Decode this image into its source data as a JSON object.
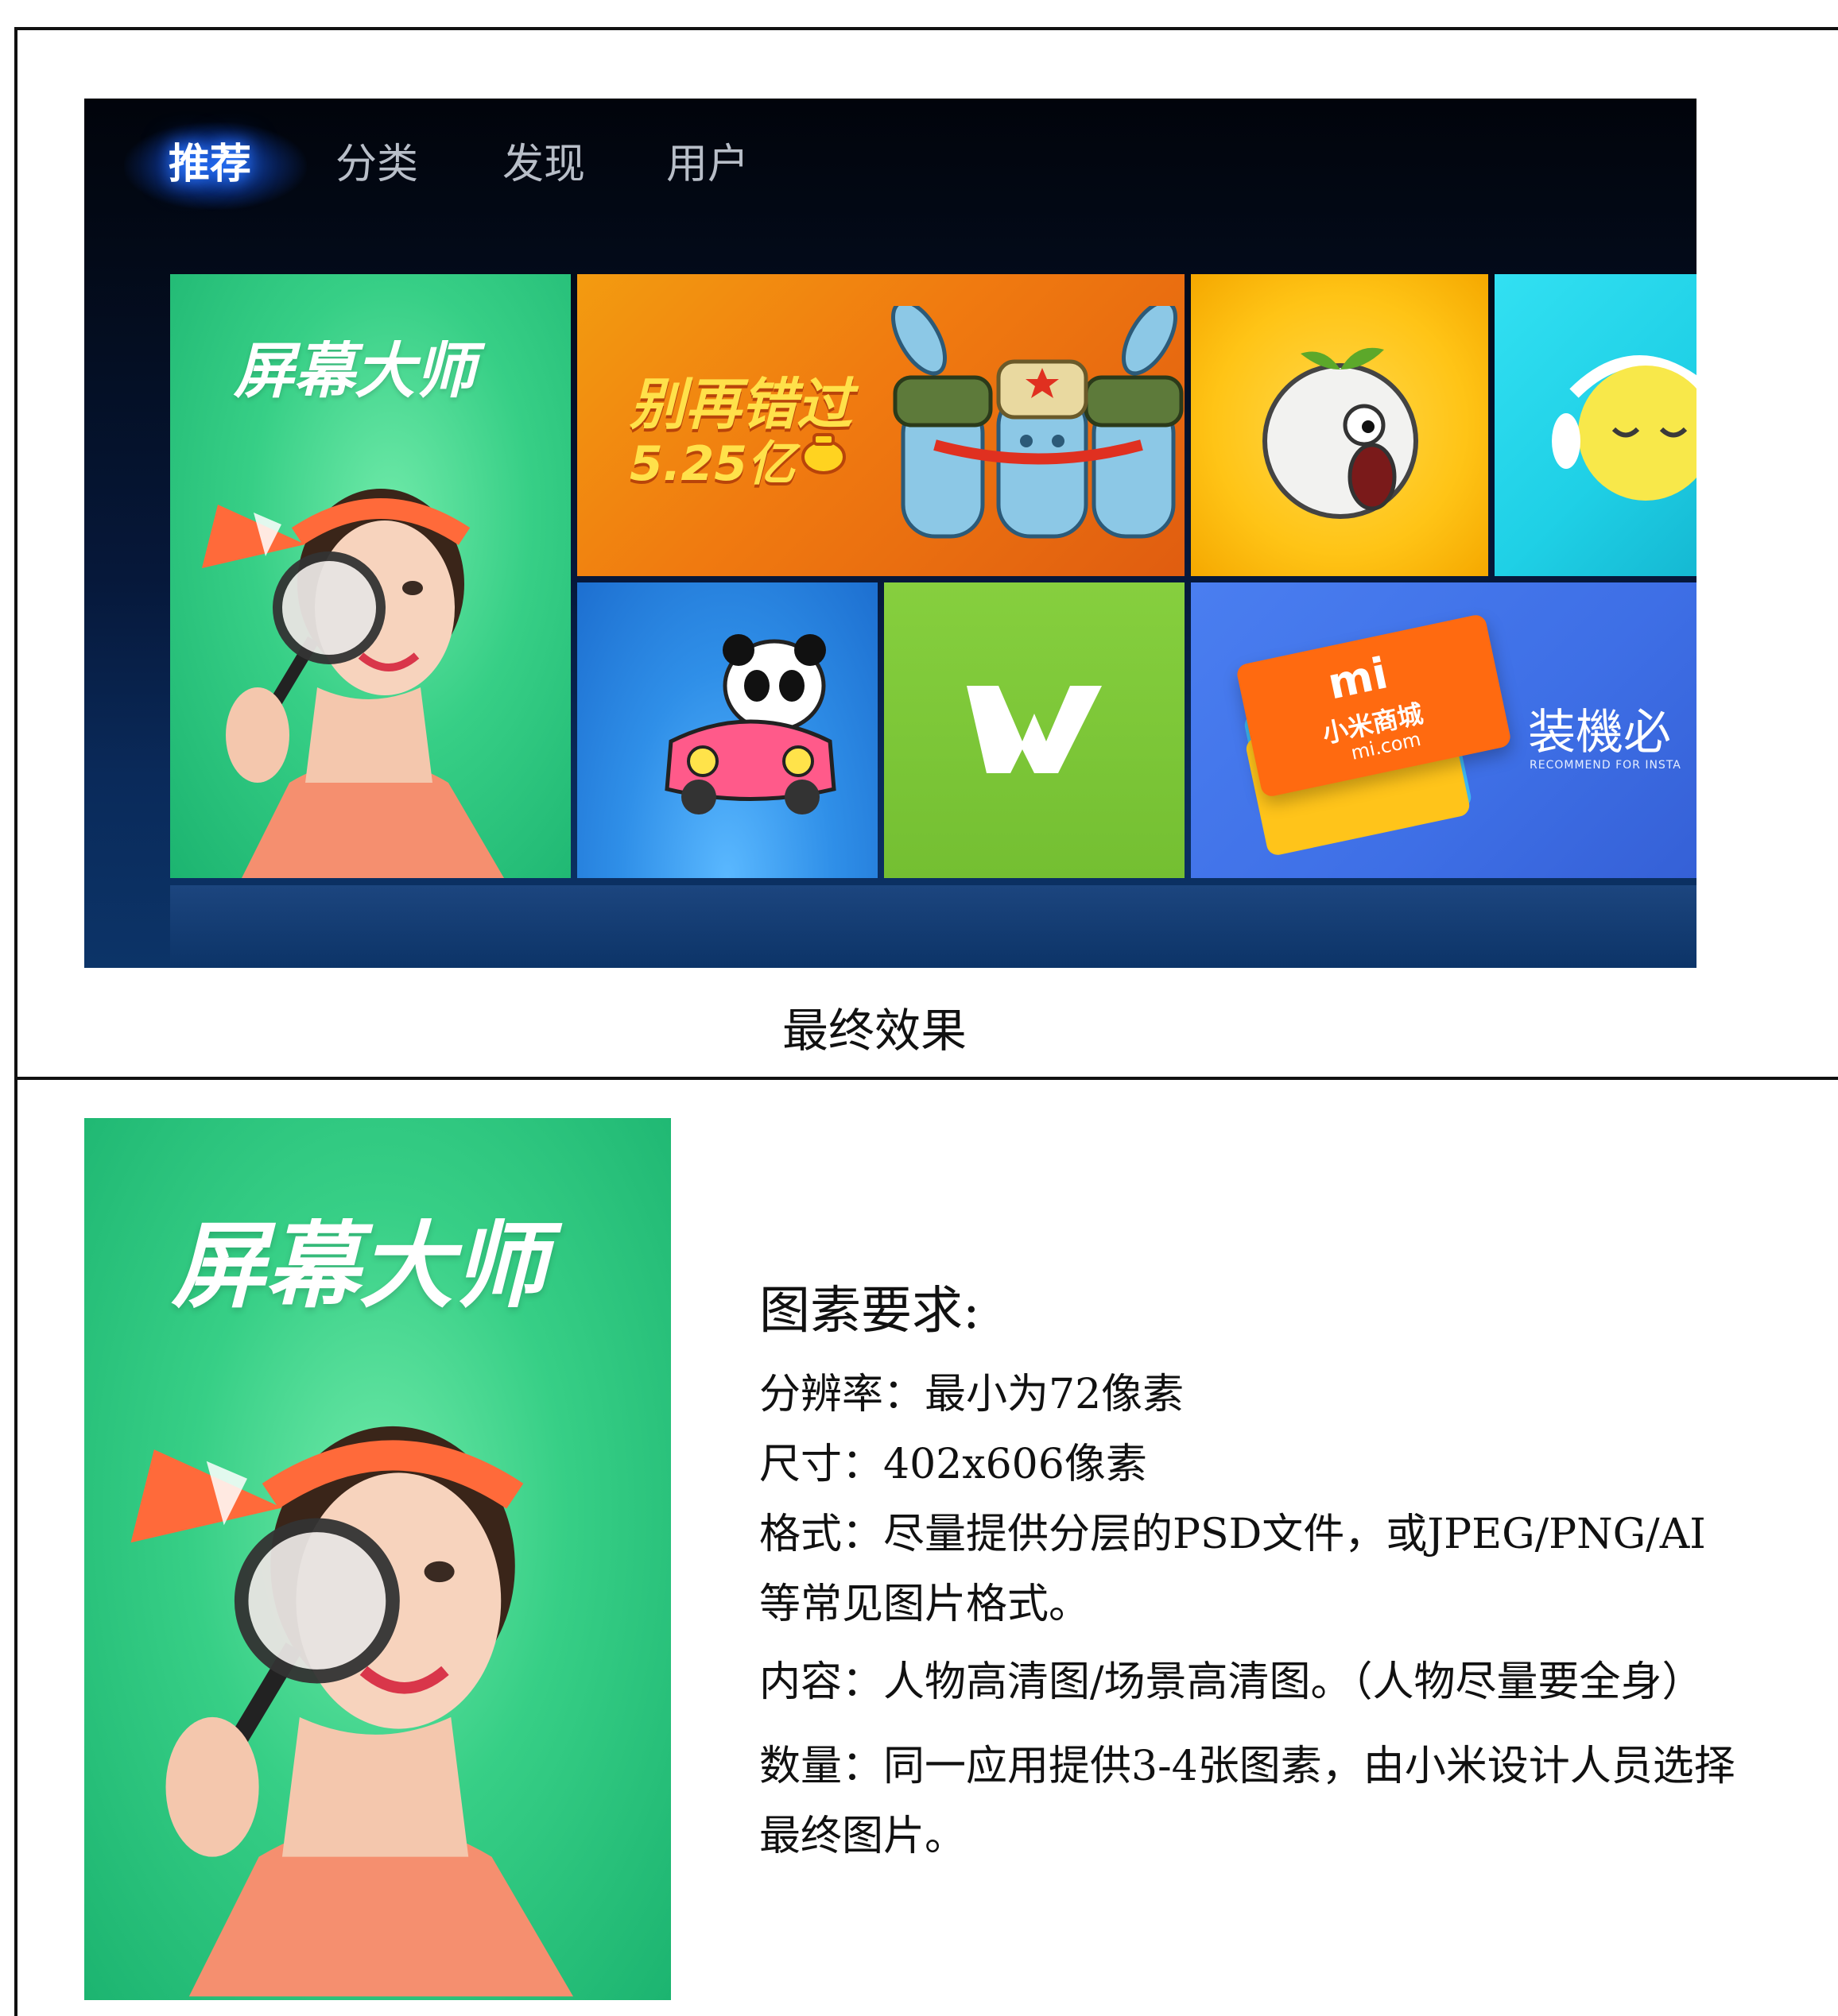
{
  "tv": {
    "nav": [
      "推荐",
      "分类",
      "发现",
      "用户"
    ],
    "tiles": {
      "feature_title": "屏幕大师",
      "promo_line1": "别再错过",
      "promo_line2": "5.25亿",
      "store_logo": "mi",
      "store_name": "小米商城",
      "store_domain": "mi.com",
      "store_banner": "装機必",
      "store_banner_sub": "RECOMMEND FOR INSTA",
      "wps_letter": "W"
    }
  },
  "caption": "最终效果",
  "poster": {
    "title": "屏幕大师"
  },
  "requirements": {
    "title": "图素要求:",
    "lines": [
      "分辨率：最小为72像素",
      "尺寸：402x606像素",
      "格式：尽量提供分层的PSD文件，或JPEG/PNG/AI",
      "等常见图片格式。",
      "内容：人物高清图/场景高清图。（人物尽量要全身）",
      "数量：同一应用提供3-4张图素，由小米设计人员选择",
      "最终图片。"
    ]
  },
  "colors": {
    "green": "#22c27a",
    "orange": "#f07a10",
    "yellow": "#ffc416",
    "cyan": "#1fd0e6",
    "blue": "#2f8fe8",
    "lime": "#7cc63a",
    "royal": "#3e6fe6"
  }
}
